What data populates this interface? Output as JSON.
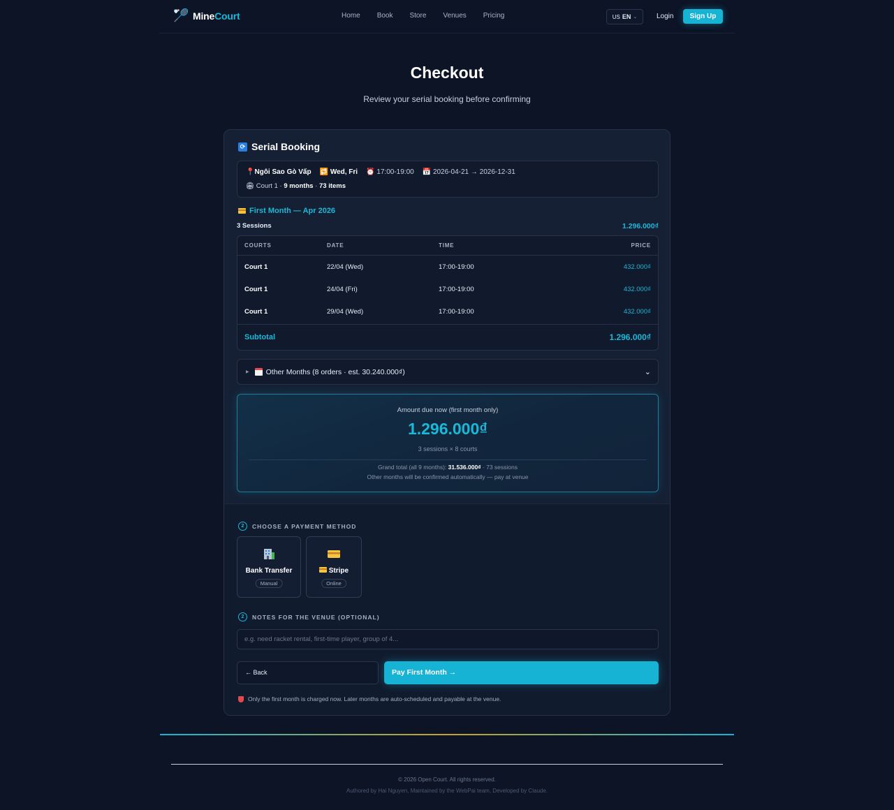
{
  "nav": {
    "brand_a": "Mine",
    "brand_b": "Court",
    "links": [
      "Home",
      "Book",
      "Store",
      "Venues",
      "Pricing"
    ],
    "lang_flag": "US",
    "lang": "EN",
    "login": "Login",
    "signup": "Sign Up"
  },
  "hero": {
    "title": "Checkout",
    "subtitle": "Review your serial booking before confirming"
  },
  "booking": {
    "title": "Serial Booking",
    "venue": "Ngôi Sao Gò Vấp",
    "days": "Wed, Fri",
    "time": "17:00-19:00",
    "date_range": "2026-04-21 → 2026-12-31",
    "court": "Court 1 · ",
    "months": "9 months",
    "dot": " · ",
    "items": "73 items"
  },
  "first_month": {
    "heading": "First Month — Apr 2026",
    "sessions_label": "3 Sessions",
    "sessions_amount": "1.296.000₫",
    "columns": [
      "COURTS",
      "DATE",
      "TIME",
      "PRICE"
    ],
    "rows": [
      {
        "court": "Court 1",
        "date": "22/04 (Wed)",
        "time": "17:00-19:00",
        "price": "432.000₫"
      },
      {
        "court": "Court 1",
        "date": "24/04 (Fri)",
        "time": "17:00-19:00",
        "price": "432.000₫"
      },
      {
        "court": "Court 1",
        "date": "29/04 (Wed)",
        "time": "17:00-19:00",
        "price": "432.000₫"
      }
    ],
    "subtotal_label": "Subtotal",
    "subtotal_amount": "1.296.000₫"
  },
  "other_months": {
    "label": "Other Months (8 orders · est. 30.240.000₫)"
  },
  "due": {
    "label": "Amount due now (first month only)",
    "amount": "1.296.000₫",
    "detail": "3 sessions × 8 courts",
    "grand_prefix": "Grand total (all 9 months): ",
    "grand_amount": "31.536.000₫",
    "grand_suffix": " · 73 sessions",
    "note": "Other months will be confirmed automatically — pay at venue"
  },
  "payment": {
    "step": "2",
    "heading": "CHOOSE A PAYMENT METHOD",
    "options": [
      {
        "name": "Bank Transfer",
        "tag": "Manual"
      },
      {
        "name": "Stripe",
        "tag": "Online"
      }
    ]
  },
  "notes": {
    "step": "2",
    "heading": "NOTES FOR THE VENUE (OPTIONAL)",
    "placeholder": "e.g. need racket rental, first-time player, group of 4..."
  },
  "actions": {
    "back": "← Back",
    "pay": "Pay First Month →",
    "disclaimer": "Only the first month is charged now. Later months are auto-scheduled and payable at the venue."
  },
  "footer": {
    "copyright": "© 2026 Open Court. All rights reserved.",
    "credits": "Authored by Hai Nguyen, Maintained by the WebPai team, Developed by Claude."
  },
  "colors": {
    "accent": "#16b3d5",
    "background": "#0c1426",
    "card": "#152035"
  }
}
